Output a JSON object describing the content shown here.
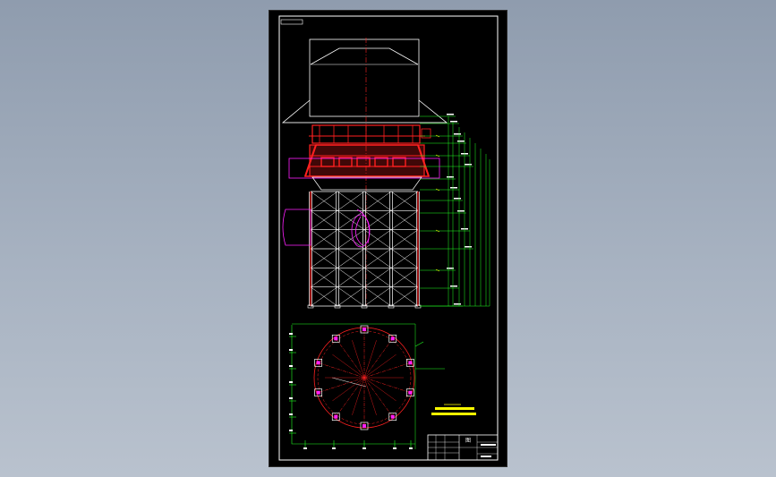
{
  "viewer": {
    "background_top": "#8f9cae",
    "background_bottom": "#b9c2ce",
    "sheet_background": "#000000"
  },
  "drawing": {
    "line_colors": {
      "frame": "#ffffff",
      "structure": "#ff2020",
      "dimension": "#20ff20",
      "highlight": "#ff20ff",
      "annotation": "#ffff00"
    },
    "elevation_view": {
      "columns": 5,
      "bays": 6
    },
    "plan_view": {
      "ring_nodes": 10,
      "radial_lines": 10
    },
    "title_block": {
      "stamp": "图",
      "sheet_code": ""
    }
  }
}
